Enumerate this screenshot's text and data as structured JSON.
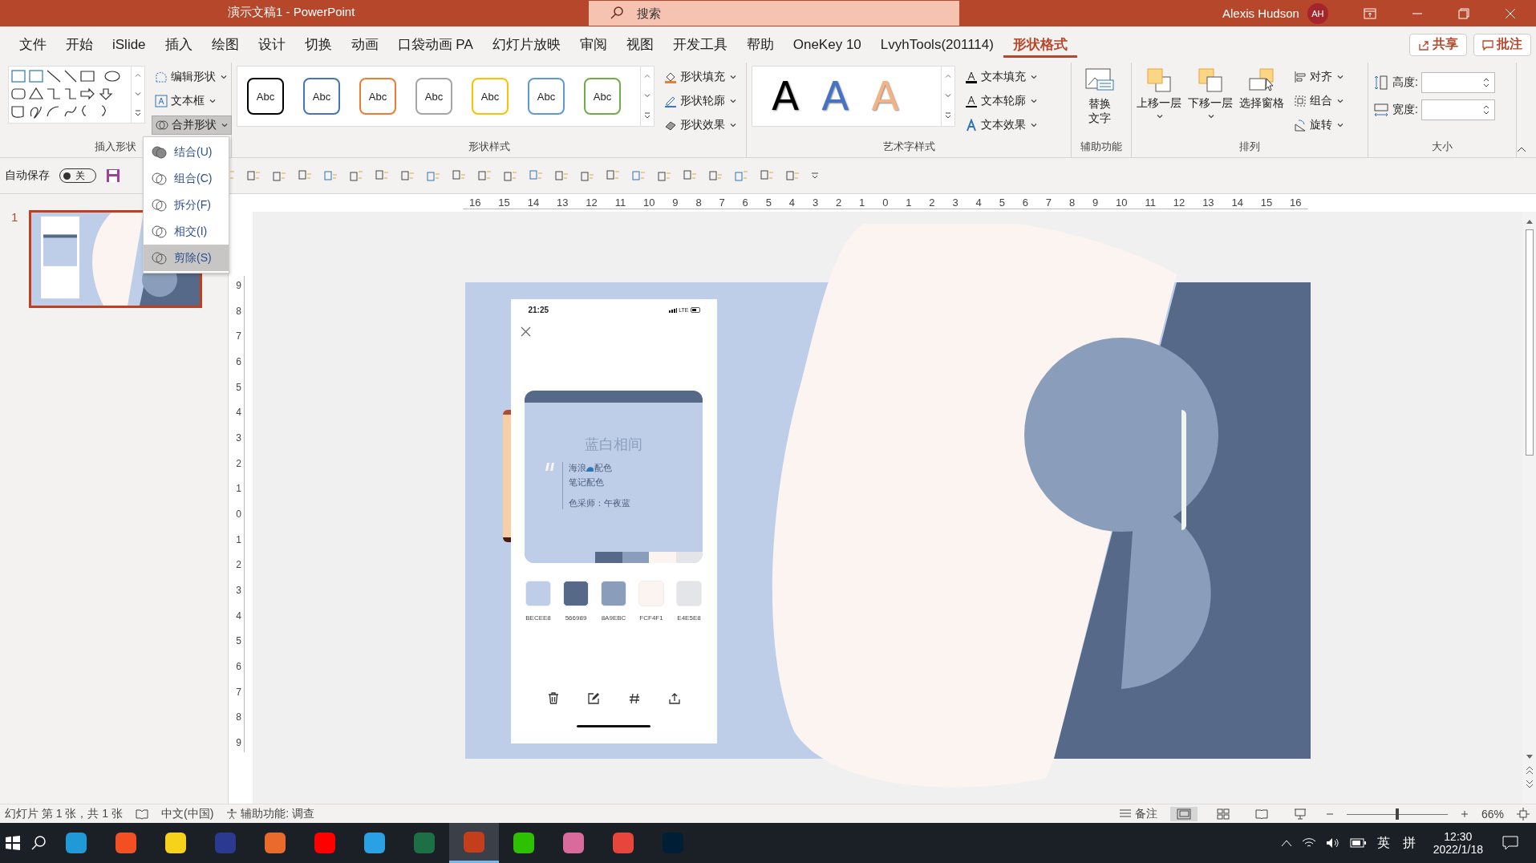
{
  "title_bar": {
    "document_title": "演示文稿1  -  PowerPoint",
    "search_placeholder": "搜索",
    "user_name": "Alexis Hudson",
    "avatar_initials": "AH"
  },
  "menu_tabs": [
    {
      "label": "文件",
      "selected": false
    },
    {
      "label": "开始",
      "selected": false
    },
    {
      "label": "iSlide",
      "selected": false
    },
    {
      "label": "插入",
      "selected": false
    },
    {
      "label": "绘图",
      "selected": false
    },
    {
      "label": "设计",
      "selected": false
    },
    {
      "label": "切换",
      "selected": false
    },
    {
      "label": "动画",
      "selected": false
    },
    {
      "label": "口袋动画 PA",
      "selected": false
    },
    {
      "label": "幻灯片放映",
      "selected": false
    },
    {
      "label": "审阅",
      "selected": false
    },
    {
      "label": "视图",
      "selected": false
    },
    {
      "label": "开发工具",
      "selected": false
    },
    {
      "label": "帮助",
      "selected": false
    },
    {
      "label": "OneKey 10",
      "selected": false
    },
    {
      "label": "LvyhTools(201114)",
      "selected": false
    },
    {
      "label": "形状格式",
      "selected": true
    }
  ],
  "share_button": "共享",
  "comments_button": "批注",
  "ribbon": {
    "insert_shapes": {
      "label": "插入形状",
      "edit_shape": "编辑形状",
      "text_box": "文本框",
      "merge_shapes": "合并形状"
    },
    "shape_styles": {
      "label": "形状样式",
      "presets": [
        {
          "label": "Abc",
          "color": "#000000"
        },
        {
          "label": "Abc",
          "color": "#4472c4"
        },
        {
          "label": "Abc",
          "color": "#ed7d31"
        },
        {
          "label": "Abc",
          "color": "#a5a5a5"
        },
        {
          "label": "Abc",
          "color": "#ffc000"
        },
        {
          "label": "Abc",
          "color": "#5b9bd5"
        },
        {
          "label": "Abc",
          "color": "#70ad47"
        }
      ],
      "fill": "形状填充",
      "outline": "形状轮廓",
      "effects": "形状效果"
    },
    "wordart": {
      "label": "艺术字样式",
      "presets": [
        {
          "label": "A",
          "color": "#000000"
        },
        {
          "label": "A",
          "color": "#4472c4"
        },
        {
          "label": "A",
          "color": "#f4b183"
        }
      ],
      "text_fill": "文本填充",
      "text_outline": "文本轮廓",
      "text_effects": "文本效果"
    },
    "accessibility": {
      "label": "辅助功能",
      "alt_text": "替换文字"
    },
    "arrange": {
      "label": "排列",
      "bring_forward": "上移一层",
      "send_backward": "下移一层",
      "selection_pane": "选择窗格",
      "align": "对齐",
      "group": "组合",
      "rotate": "旋转"
    },
    "size": {
      "label": "大小",
      "height_label": "高度:",
      "width_label": "宽度:"
    }
  },
  "merge_menu": [
    {
      "label": "结合(U)",
      "selected": false
    },
    {
      "label": "组合(C)",
      "selected": false
    },
    {
      "label": "拆分(F)",
      "selected": false
    },
    {
      "label": "相交(I)",
      "selected": false
    },
    {
      "label": "剪除(S)",
      "selected": true
    }
  ],
  "quick_access": {
    "autosave_label": "自动保存",
    "autosave_toggle": {
      "on": false,
      "label": "关"
    }
  },
  "rulers": {
    "horizontal": [
      "16",
      "15",
      "14",
      "13",
      "12",
      "11",
      "10",
      "9",
      "8",
      "7",
      "6",
      "5",
      "4",
      "3",
      "2",
      "1",
      "0",
      "1",
      "2",
      "3",
      "4",
      "5",
      "6",
      "7",
      "8",
      "9",
      "10",
      "11",
      "12",
      "13",
      "14",
      "15",
      "16"
    ],
    "vertical": [
      "9",
      "8",
      "7",
      "6",
      "5",
      "4",
      "3",
      "2",
      "1",
      "0",
      "1",
      "2",
      "3",
      "4",
      "5",
      "6",
      "7",
      "8",
      "9"
    ]
  },
  "thumbnails": [
    {
      "number": "1",
      "selected": true
    }
  ],
  "phone": {
    "time": "21:25",
    "network": "LTE",
    "card_title": "蓝白相间",
    "quote_word_before": "海浪",
    "quote_word_after": "配色",
    "quote_line_2": "笔记配色",
    "quote_author": "色采师：午夜蓝",
    "swatches": [
      {
        "code": "BECEE8",
        "color": "#becee8"
      },
      {
        "code": "566989",
        "color": "#566989"
      },
      {
        "code": "8A9EBC",
        "color": "#8a9ebc"
      },
      {
        "code": "FCF4F1",
        "color": "#fcf4f1"
      },
      {
        "code": "E4E5E8",
        "color": "#e4e5e8"
      }
    ]
  },
  "status_bar": {
    "slide_info": "幻灯片 第 1 张，共 1 张",
    "language": "中文(中国)",
    "accessibility": "辅助功能: 调查",
    "notes": "备注",
    "zoom_slider": {
      "level": 0.5
    },
    "zoom_percent": "66%"
  },
  "taskbar": {
    "input_language": "英",
    "input_method": "拼",
    "time": "12:30",
    "date": "2022/1/18"
  }
}
